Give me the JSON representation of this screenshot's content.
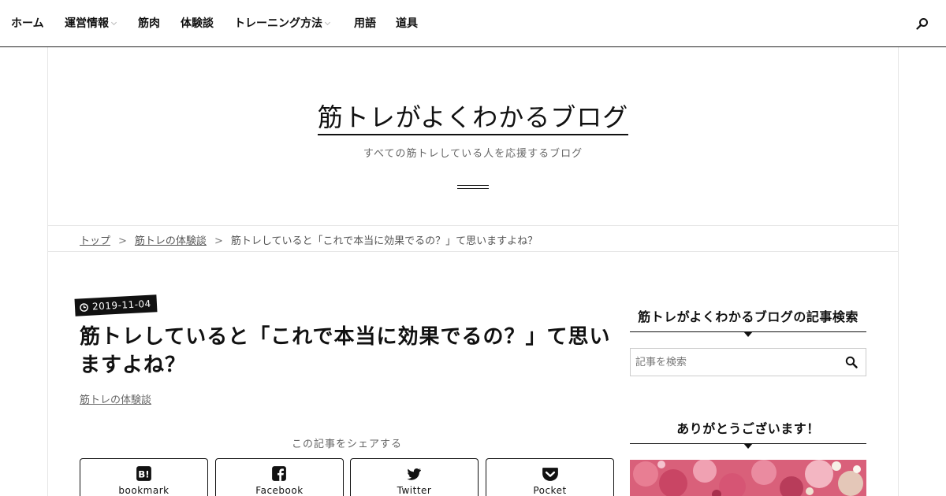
{
  "nav": {
    "items": [
      {
        "label": "ホーム"
      },
      {
        "label": "運営情報"
      },
      {
        "label": "筋肉"
      },
      {
        "label": "体験談"
      },
      {
        "label": "トレーニング方法"
      },
      {
        "label": "用語"
      },
      {
        "label": "道具"
      }
    ],
    "search_icon": "search-icon"
  },
  "site": {
    "title": "筋トレがよくわかるブログ",
    "tagline": "すべての筋トレしている人を応援するブログ"
  },
  "breadcrumb": {
    "items": [
      "トップ",
      "筋トレの体験談"
    ],
    "separator": ">",
    "current": "筋トレしていると「これで本当に効果でるの？」て思いますよね？"
  },
  "article": {
    "date": "2019-11-04",
    "title": "筋トレしていると「これで本当に効果でるの？」て思いますよね？",
    "category": "筋トレの体験談",
    "share_label": "この記事をシェアする",
    "share_buttons": [
      {
        "label": "bookmark",
        "icon": "hatena-bookmark-icon"
      },
      {
        "label": "Facebook",
        "icon": "facebook-icon"
      },
      {
        "label": "Twitter",
        "icon": "twitter-icon"
      },
      {
        "label": "Pocket",
        "icon": "pocket-icon"
      }
    ]
  },
  "sidebar": {
    "search_widget": {
      "title": "筋トレがよくわかるブログの記事検索",
      "placeholder": "記事を検索"
    },
    "thanks_widget": {
      "title": "ありがとうございます！"
    }
  },
  "colors": {
    "text": "#111111",
    "muted": "#666666",
    "border": "#e6e6e6",
    "badge_bg": "#111111"
  }
}
